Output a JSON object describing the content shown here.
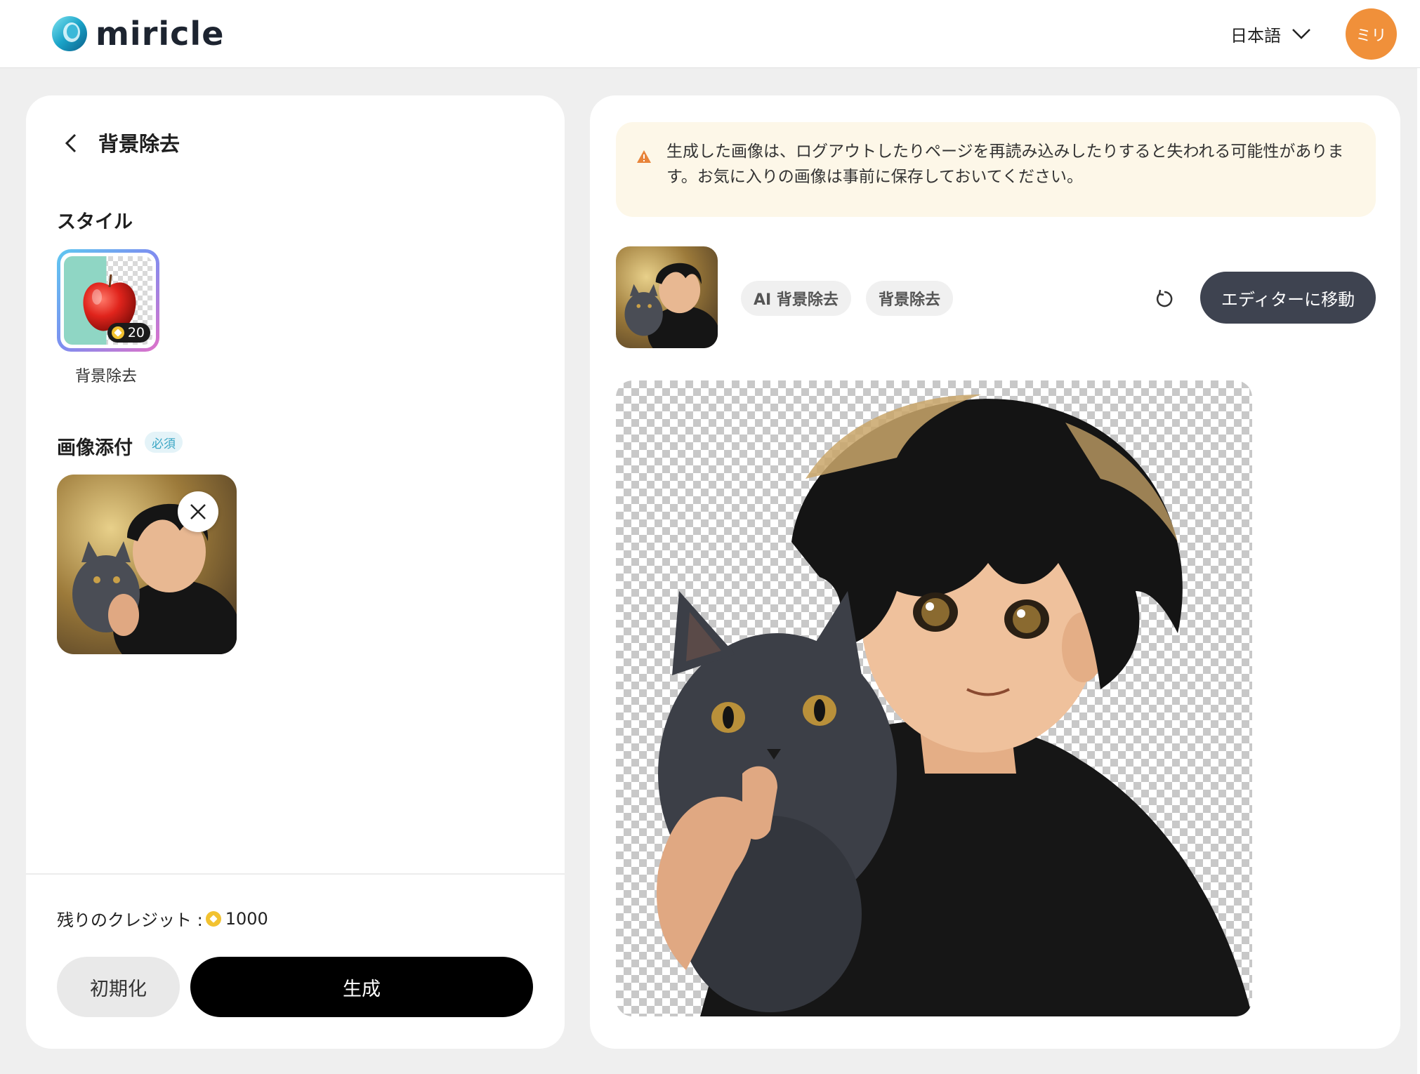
{
  "header": {
    "brand": "miricle",
    "language": "日本語",
    "avatar_text": "ミリ"
  },
  "left_panel": {
    "title": "背景除去",
    "style_section_label": "スタイル",
    "style_option": {
      "label": "背景除去",
      "credit_cost": "20",
      "selected": true
    },
    "attach_section_label": "画像添付",
    "required_badge": "必須",
    "credits_label": "残りのクレジット :",
    "credits_value": "1000",
    "reset_button": "初期化",
    "generate_button": "生成"
  },
  "right_panel": {
    "warning_text": "生成した画像は、ログアウトしたりページを再読み込みしたりすると失われる可能性があります。お気に入りの画像は事前に保存しておいてください。",
    "tags": [
      "AI 背景除去",
      "背景除去"
    ],
    "editor_button": "エディターに移動"
  },
  "colors": {
    "accent_orange": "#f0903a",
    "dark_button": "#3e4350",
    "warning_bg": "#fdf7e8",
    "coin_gold": "#f2c230"
  }
}
